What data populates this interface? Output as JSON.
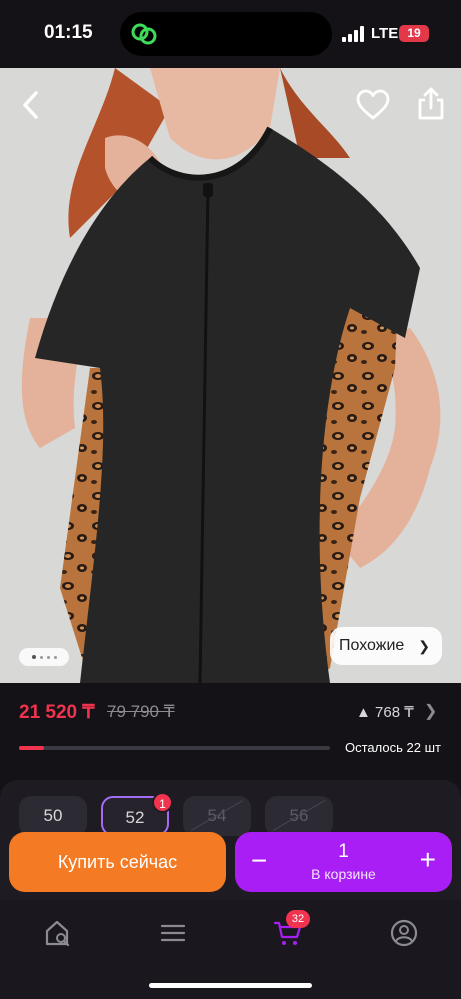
{
  "status_bar": {
    "time": "01:15",
    "network": "LTE",
    "battery": "19",
    "battery_color": "#e2384a"
  },
  "product": {
    "gallery": {
      "similar_label": "Похожие",
      "page_indicator": {
        "count": 4,
        "active": 0
      },
      "icons": [
        "back-icon",
        "heart-icon",
        "share-icon"
      ]
    },
    "price": {
      "current": "21 520 ₸",
      "old": "79 790 ₸",
      "bonus": "768 ₸",
      "accent_color": "#f0334f"
    },
    "stock": {
      "label": "Осталось 22 шт",
      "progress": 0.08
    },
    "sizes": [
      {
        "label": "50",
        "state": "available"
      },
      {
        "label": "52",
        "state": "selected",
        "badge": "1"
      },
      {
        "label": "54",
        "state": "unavailable"
      },
      {
        "label": "56",
        "state": "unavailable"
      }
    ]
  },
  "actions": {
    "buy_now": "Купить сейчас",
    "buy_color": "#f57a24",
    "cart": {
      "quantity": "1",
      "label": "В корзине",
      "minus": "−",
      "plus": "+",
      "color": "#a91ef5"
    }
  },
  "bottom_nav": {
    "items": [
      {
        "name": "home-search",
        "icon": "home-search-icon"
      },
      {
        "name": "catalog",
        "icon": "menu-icon"
      },
      {
        "name": "cart",
        "icon": "cart-icon",
        "badge": "32"
      },
      {
        "name": "profile",
        "icon": "profile-icon"
      }
    ]
  }
}
